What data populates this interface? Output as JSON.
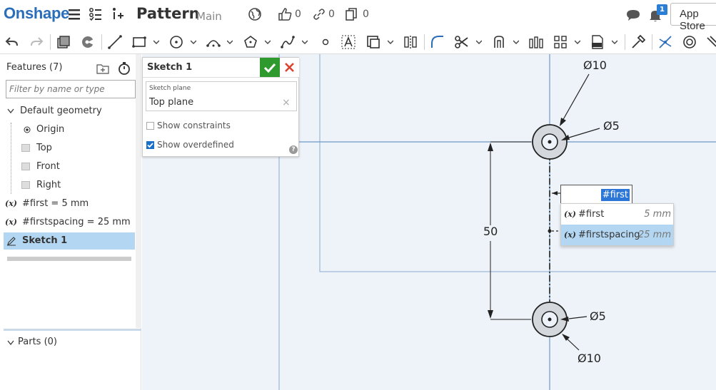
{
  "header": {
    "logo": "Onshape",
    "document_title": "Pattern",
    "branch": "Main",
    "likes_count": "0",
    "links_count": "0",
    "copies_count": "0",
    "notifications_badge": "1",
    "app_store_label": "App Store"
  },
  "features_panel": {
    "title": "Features (7)",
    "filter_placeholder": "Filter by name or type",
    "default_geometry_label": "Default geometry",
    "items": [
      {
        "label": "Origin",
        "icon": "origin-icon"
      },
      {
        "label": "Top",
        "icon": "plane-icon"
      },
      {
        "label": "Front",
        "icon": "plane-icon"
      },
      {
        "label": "Right",
        "icon": "plane-icon"
      }
    ],
    "variables": [
      {
        "icon_text": "(x)",
        "label": "#first = 5 mm"
      },
      {
        "icon_text": "(x)",
        "label": "#firstspacing = 25 mm"
      }
    ],
    "sketch_label": "Sketch 1",
    "parts_label": "Parts (0)"
  },
  "sketch_dialog": {
    "title": "Sketch 1",
    "plane_label": "Sketch plane",
    "plane_value": "Top plane",
    "plane_clear": "×",
    "show_constraints_label": "Show constraints",
    "show_constraints_checked": false,
    "show_overdefined_label": "Show overdefined",
    "show_overdefined_checked": true,
    "help_label": "?"
  },
  "canvas": {
    "dim_top_large": "Ø10",
    "dim_top_small": "Ø5",
    "dim_bottom_small": "Ø5",
    "dim_bottom_large": "Ø10",
    "dim_vertical": "50",
    "dimension_input_value": "#first",
    "autocomplete": [
      {
        "icon_text": "(x)",
        "name": "#first",
        "value": "5 mm",
        "highlighted": false
      },
      {
        "icon_text": "(x)",
        "name": "#firstspacing",
        "value": "25 mm",
        "highlighted": true
      }
    ]
  },
  "colors": {
    "brand": "#2a6ebb",
    "accept": "#2e9a2e",
    "cancel": "#d9432f",
    "selection": "#b3d7f2",
    "canvas_bg": "#eef3f9"
  }
}
